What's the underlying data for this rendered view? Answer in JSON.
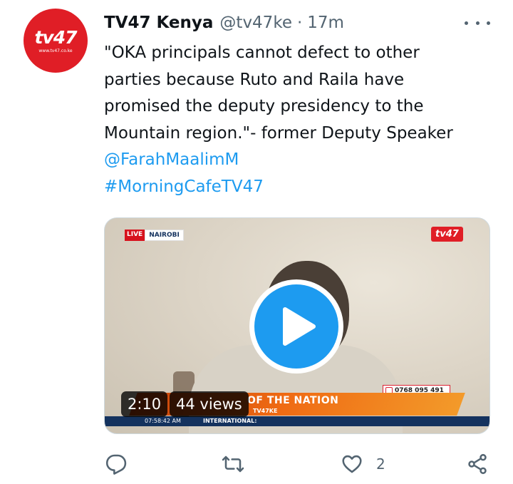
{
  "account": {
    "avatar_logo": "tv47",
    "avatar_site": "www.tv47.co.ke",
    "name": "TV47 Kenya",
    "handle": "@tv47ke",
    "separator": "·",
    "time": "17m"
  },
  "tweet": {
    "lines": [
      "\"OKA principals cannot defect to other",
      "parties because Ruto and Raila have",
      "promised the deputy presidency to the",
      "Mountain region.\"- former Deputy Speaker"
    ],
    "mention": "@FarahMaalimM",
    "hashtag": "#MorningCafeTV47"
  },
  "video": {
    "live_label": "LIVE",
    "location_label": "NAIROBI",
    "channel_badge": "tv47",
    "phone": "0768 095 491",
    "banner_title": "OF THE NATION",
    "banner_sub": "TV47KE",
    "ticker_time": "07:58:42 AM",
    "ticker_label": "INTERNATIONAL:",
    "duration": "2:10",
    "views": "44 views"
  },
  "actions": {
    "like_count": "2"
  },
  "colors": {
    "accent": "#1d9bf0",
    "brand_red": "#e01e26",
    "muted": "#536471"
  },
  "icons": [
    "more-icon",
    "play-icon",
    "reply-icon",
    "retweet-icon",
    "like-icon",
    "share-icon"
  ]
}
